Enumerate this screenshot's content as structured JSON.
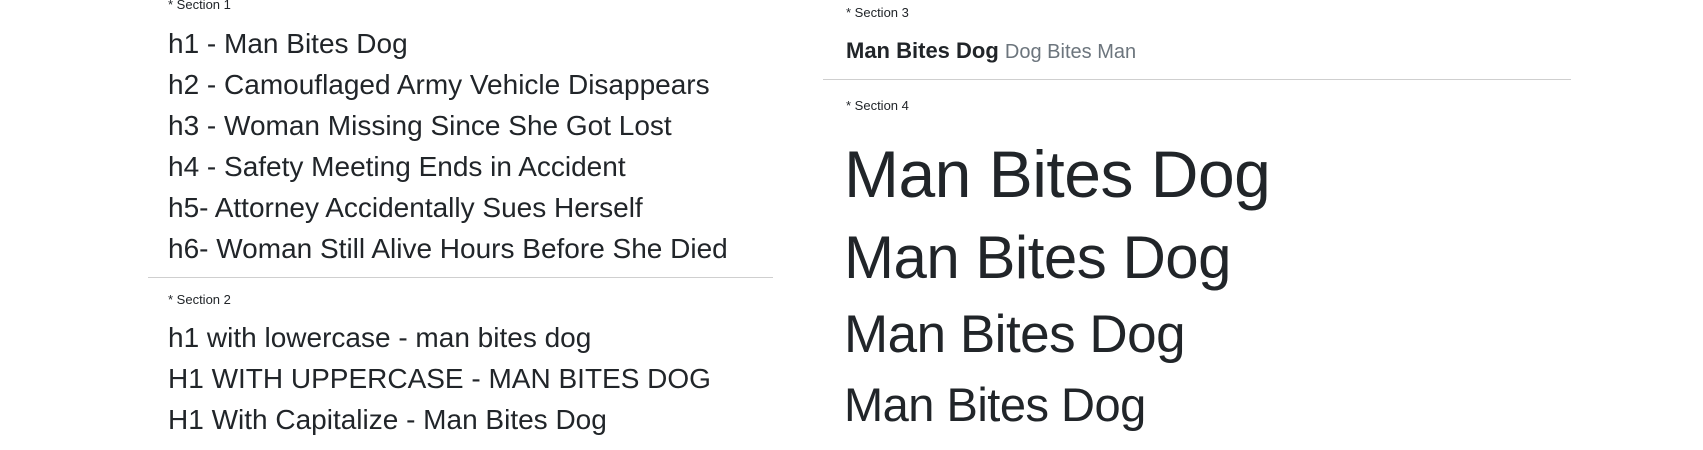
{
  "section1": {
    "label": "* Section 1",
    "headings": [
      "h1 - Man Bites Dog",
      "h2 - Camouflaged Army Vehicle Disappears",
      "h3 - Woman Missing Since She Got Lost",
      "h4 - Safety Meeting Ends in Accident",
      "h5- Attorney Accidentally Sues Herself",
      "h6- Woman Still Alive Hours Before She Died"
    ]
  },
  "section2": {
    "label": "* Section 2",
    "headings": [
      "h1 with lowercase - man bites dog",
      "H1 WITH UPPERCASE - MAN BITES DOG",
      "H1 With Capitalize - Man Bites Dog"
    ]
  },
  "section3": {
    "label": "* Section 3",
    "main_text": "Man Bites Dog",
    "secondary_text": "Dog Bites Man"
  },
  "section4": {
    "label": "* Section 4",
    "displays": [
      "Man Bites Dog",
      "Man Bites Dog",
      "Man Bites Dog",
      "Man Bites Dog"
    ]
  },
  "colors": {
    "text": "#212529",
    "muted": "#6c757d",
    "divider": "#cfcfcf"
  }
}
